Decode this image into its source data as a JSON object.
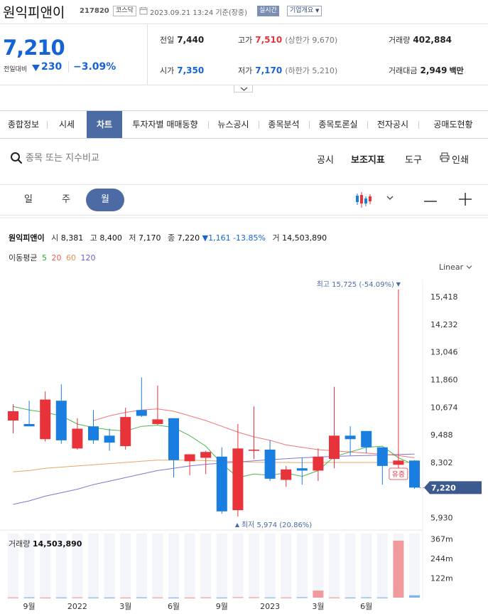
{
  "header": {
    "stock_name": "원익피앤이",
    "stock_code": "217820",
    "market": "코스닥",
    "timestamp": "2023.09.21 13:24 기준(장중)",
    "realtime": "실시간",
    "company_info": "기업개요"
  },
  "quote": {
    "price": "7,210",
    "change_label": "전일대비",
    "change": "230",
    "change_pct": "−3.09%",
    "prev_close_label": "전일",
    "prev_close": "7,440",
    "open_label": "시가",
    "open": "7,350",
    "high_label": "고가",
    "high": "7,510",
    "upper_limit": "(상한가 9,670)",
    "low_label": "저가",
    "low": "7,170",
    "lower_limit": "(하한가 5,210)",
    "volume_label": "거래량",
    "volume": "402,884",
    "value_label": "거래대금",
    "value": "2,949",
    "value_unit": "백만"
  },
  "tabs": [
    {
      "label": "종합정보",
      "w": 66
    },
    {
      "label": "시세",
      "w": 56
    },
    {
      "label": "차트",
      "w": 50,
      "active": true
    },
    {
      "label": "투자자별 매매동향",
      "w": 121
    },
    {
      "label": "뉴스공시",
      "w": 71
    },
    {
      "label": "종목분석",
      "w": 71
    },
    {
      "label": "종목토론실",
      "w": 82
    },
    {
      "label": "전자공시",
      "w": 72
    },
    {
      "label": "공매도현황",
      "w": 98
    }
  ],
  "toolbar": {
    "search_placeholder": "종목 또는 지수비교",
    "disclosure": "공시",
    "indicator": "보조지표",
    "tools": "도구",
    "print": "인쇄"
  },
  "periods": [
    {
      "label": "일"
    },
    {
      "label": "주"
    },
    {
      "label": "월",
      "active": true
    }
  ],
  "chart_header": {
    "name": "원익피앤이",
    "open_label": "시",
    "open": "8,381",
    "high_label": "고",
    "high": "8,400",
    "low_label": "저",
    "low": "7,170",
    "close_label": "종",
    "close": "7,220",
    "change": "1,161 -13.85%",
    "vol_label": "거",
    "vol": "14,503,890",
    "ma_label": "이동평균",
    "scale": "Linear",
    "vol_title": "거래량",
    "vol_value": "14,503,890"
  },
  "chart_data": {
    "type": "candlestick",
    "ylim": [
      5550,
      16150
    ],
    "y_ticks": [
      15418,
      14232,
      13046,
      11860,
      10674,
      9488,
      8302,
      5930
    ],
    "y_tick_labels": [
      "15,418",
      "14,232",
      "13,046",
      "11,860",
      "10,674",
      "9,488",
      "8,302",
      "5,930"
    ],
    "current_price": 7220,
    "current_label": "7,220",
    "x_tick_labels": [
      {
        "index": 1,
        "label": "9월"
      },
      {
        "index": 4,
        "label": "2022"
      },
      {
        "index": 7,
        "label": "3월"
      },
      {
        "index": 10,
        "label": "6월"
      },
      {
        "index": 13,
        "label": "9월"
      },
      {
        "index": 16,
        "label": "2023"
      },
      {
        "index": 19,
        "label": "3월"
      },
      {
        "index": 22,
        "label": "6월"
      }
    ],
    "candles": [
      {
        "o": 10100,
        "h": 10800,
        "l": 9550,
        "c": 10500
      },
      {
        "o": 9950,
        "h": 10950,
        "l": 9900,
        "c": 9850
      },
      {
        "o": 9300,
        "h": 11350,
        "l": 9200,
        "c": 11000
      },
      {
        "o": 10950,
        "h": 11650,
        "l": 9100,
        "c": 9250
      },
      {
        "o": 8900,
        "h": 10200,
        "l": 8850,
        "c": 9750
      },
      {
        "o": 9850,
        "h": 10550,
        "l": 9100,
        "c": 9250
      },
      {
        "o": 9450,
        "h": 9750,
        "l": 8800,
        "c": 9150
      },
      {
        "o": 9000,
        "h": 10650,
        "l": 8850,
        "c": 10250
      },
      {
        "o": 10550,
        "h": 11950,
        "l": 10250,
        "c": 10300
      },
      {
        "o": 9950,
        "h": 11600,
        "l": 9900,
        "c": 10150
      },
      {
        "o": 10200,
        "h": 10200,
        "l": 7650,
        "c": 8400
      },
      {
        "o": 8350,
        "h": 8550,
        "l": 7750,
        "c": 8650
      },
      {
        "o": 8500,
        "h": 8800,
        "l": 7800,
        "c": 8750
      },
      {
        "o": 8550,
        "h": 8950,
        "l": 6100,
        "c": 6200
      },
      {
        "o": 6250,
        "h": 9950,
        "l": 5974,
        "c": 8900
      },
      {
        "o": 8800,
        "h": 10700,
        "l": 8450,
        "c": 8850
      },
      {
        "o": 8850,
        "h": 9250,
        "l": 7500,
        "c": 7600
      },
      {
        "o": 7550,
        "h": 8150,
        "l": 7250,
        "c": 8000
      },
      {
        "o": 8050,
        "h": 8500,
        "l": 7350,
        "c": 7950
      },
      {
        "o": 7950,
        "h": 8900,
        "l": 7500,
        "c": 8550
      },
      {
        "o": 8450,
        "h": 11550,
        "l": 8050,
        "c": 9450
      },
      {
        "o": 9450,
        "h": 9850,
        "l": 8600,
        "c": 9300
      },
      {
        "o": 9650,
        "h": 9650,
        "l": 8700,
        "c": 8950
      },
      {
        "o": 8950,
        "h": 8950,
        "l": 7350,
        "c": 8150
      },
      {
        "o": 8200,
        "h": 15725,
        "l": 7900,
        "c": 8381
      },
      {
        "o": 8381,
        "h": 8400,
        "l": 7170,
        "c": 7220
      }
    ],
    "ma5": [
      10700,
      10550,
      10450,
      10300,
      9950,
      9800,
      9700,
      9650,
      9850,
      9900,
      9800,
      9450,
      9000,
      8250,
      7650,
      7800,
      7750,
      7850,
      7700,
      7950,
      8550,
      8750,
      8950,
      9000,
      8500,
      8200
    ],
    "ma20": [
      null,
      null,
      null,
      null,
      null,
      10100,
      10300,
      10450,
      10550,
      10600,
      10500,
      10300,
      10100,
      9850,
      9600,
      9400,
      9250,
      9050,
      8950,
      8850,
      8800,
      8750,
      8700,
      8650,
      8600,
      8500
    ],
    "ma60": [
      7900,
      7950,
      8050,
      8100,
      8150,
      8200,
      8250,
      8300,
      8350,
      8400,
      8400,
      8400,
      8380,
      8350,
      8330,
      8310,
      8300,
      8300,
      8290,
      8300,
      8300,
      8300,
      8300,
      8300,
      8300,
      8300
    ],
    "ma120": [
      6500,
      6650,
      6850,
      7000,
      7150,
      7350,
      7500,
      7650,
      7800,
      7950,
      8050,
      8150,
      8220,
      8270,
      8320,
      8370,
      8420,
      8460,
      8500,
      8530,
      8560,
      8580,
      8600,
      8620,
      8640,
      8660
    ],
    "annotations": {
      "max_label": "최고 15,725 (-54.09%)",
      "min_label": "최저 5,974 (20.86%)",
      "rights_issue_label": "유증"
    },
    "volume": {
      "ylim": [
        0,
        400
      ],
      "ticks": [
        367,
        244,
        122
      ],
      "tick_labels": [
        "367m",
        "244m",
        "122m"
      ],
      "values": [
        1.5,
        2,
        1,
        1.5,
        2,
        1.5,
        1,
        1,
        2,
        1.5,
        1,
        1,
        2,
        1,
        3,
        2.5,
        1.5,
        1.5,
        3,
        44,
        1.5,
        1,
        2,
        1.5,
        356,
        14.5
      ]
    }
  },
  "colors": {
    "up": "#e8333a",
    "down": "#1a7de0",
    "accent": "#4c6aa3",
    "ma5": "#2cad2c",
    "ma20": "#ef5d5d",
    "ma60": "#e0964f",
    "ma120": "#6e5cc8"
  }
}
